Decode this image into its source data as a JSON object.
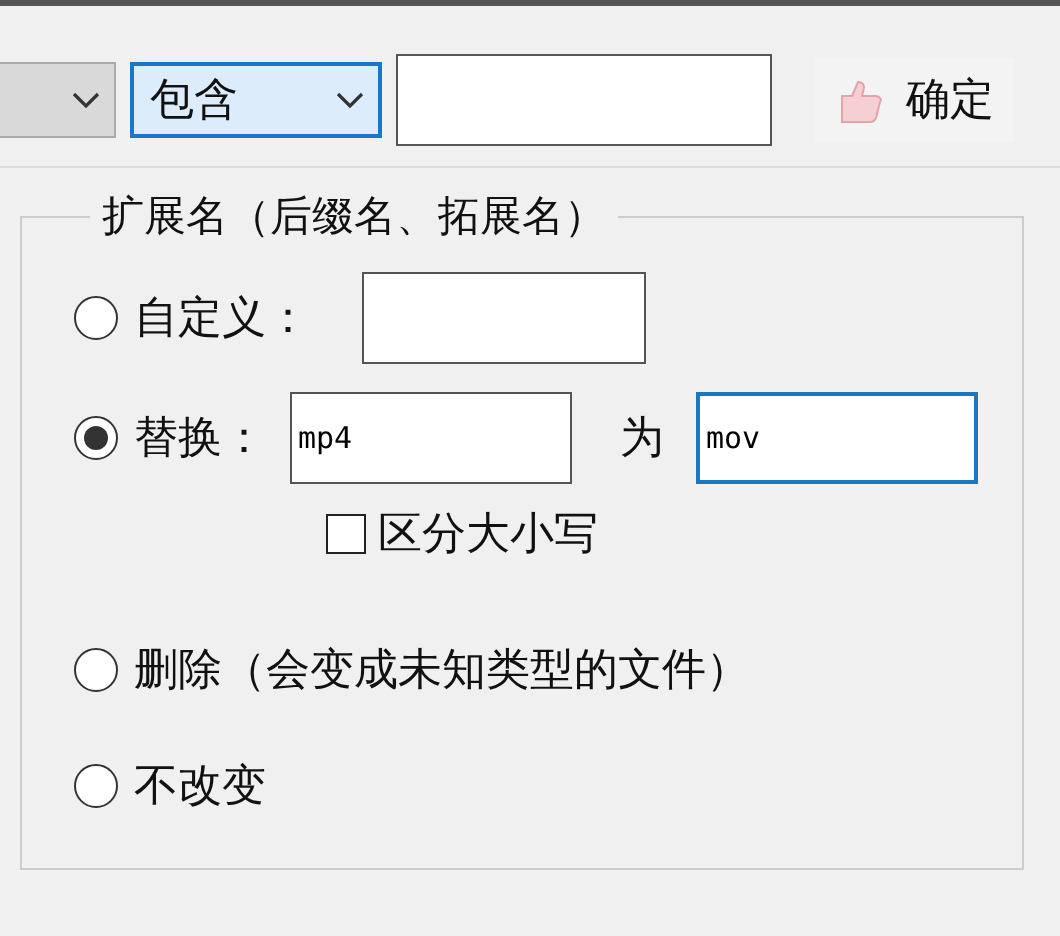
{
  "toolbar": {
    "match_select": {
      "value": "包含"
    },
    "confirm_button": {
      "label": "确定"
    }
  },
  "extension_group": {
    "title": "扩展名（后缀名、拓展名）",
    "options": [
      {
        "kind": "custom",
        "label": "自定义：",
        "selected": false
      },
      {
        "kind": "replace",
        "label": "替换：",
        "selected": true,
        "from": "mp4",
        "joiner": "为",
        "to": "mov",
        "case_option": {
          "label": "区分大小写",
          "checked": false
        }
      },
      {
        "kind": "plain",
        "label": "删除（会变成未知类型的文件）",
        "selected": false
      },
      {
        "kind": "plain",
        "label": "不改变",
        "selected": false
      }
    ]
  }
}
